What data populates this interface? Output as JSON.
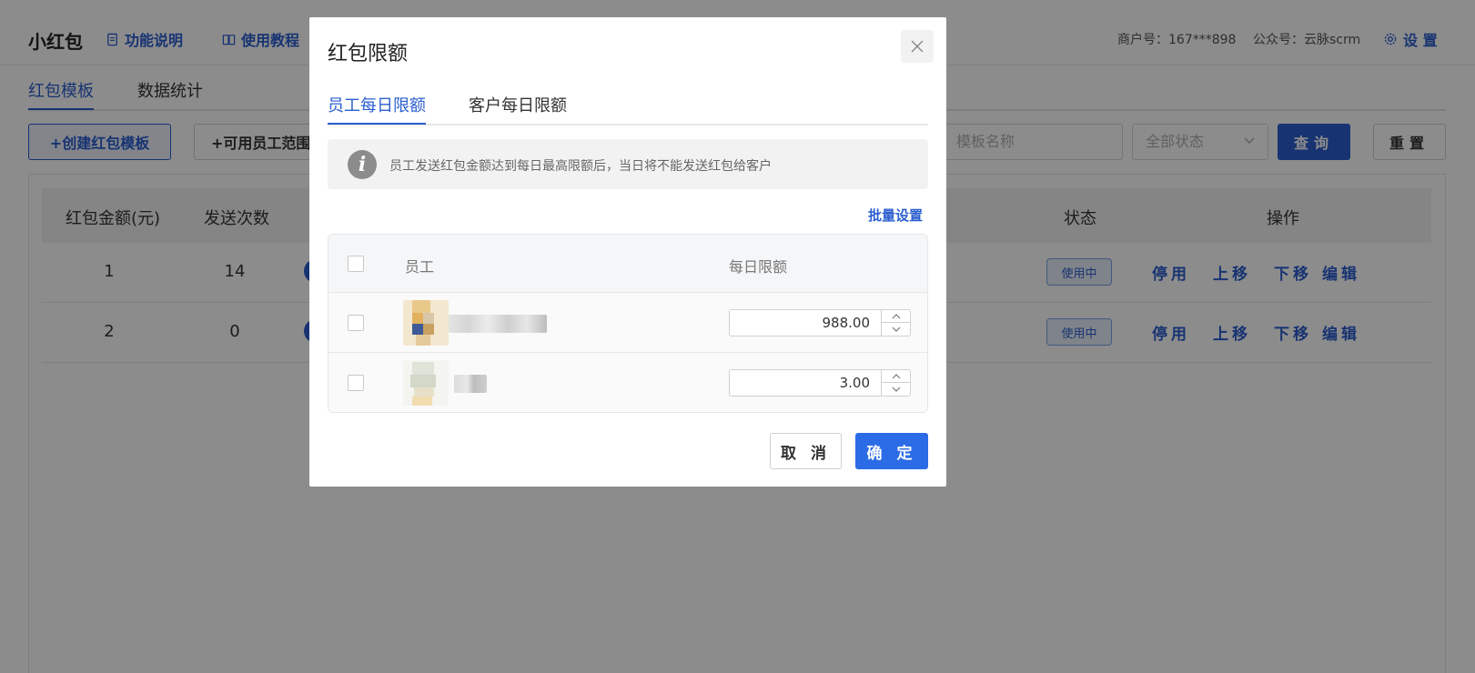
{
  "header": {
    "app_title": "小红包",
    "links": [
      "功能说明",
      "使用教程"
    ],
    "merchant": "商户号：167***898",
    "official_account": "公众号：云脉scrm",
    "settings": "设 置"
  },
  "page_tabs": [
    "红包模板",
    "数据统计"
  ],
  "toolbar": {
    "create_template": "+创建红包模板",
    "staff_range": "+可用员工范围",
    "template_name_placeholder": "模板名称",
    "status_select": "全部状态",
    "query": "查询",
    "reset": "重置"
  },
  "table": {
    "headers": [
      "红包金额(元)",
      "发送次数",
      "状态",
      "操作"
    ],
    "rows": [
      {
        "amount": "1",
        "count": "14",
        "status": "使用中"
      },
      {
        "amount": "2",
        "count": "0",
        "status": "使用中"
      }
    ],
    "actions": [
      "停用",
      "上移",
      "下移",
      "编辑"
    ]
  },
  "modal": {
    "title": "红包限额",
    "tabs": [
      "员工每日限额",
      "客户每日限额"
    ],
    "notice": "员工发送红包金额达到每日最高限额后，当日将不能发送红包给客户",
    "batch_set": "批量设置",
    "columns": [
      "员工",
      "每日限额"
    ],
    "employees": [
      {
        "limit": "988.00"
      },
      {
        "limit": "3.00"
      }
    ],
    "cancel": "取 消",
    "confirm": "确 定"
  },
  "colors": {
    "primary": "#2b5ecf",
    "confirm_button": "#2b6be6",
    "overlay": "rgba(0,0,0,0.45)"
  }
}
